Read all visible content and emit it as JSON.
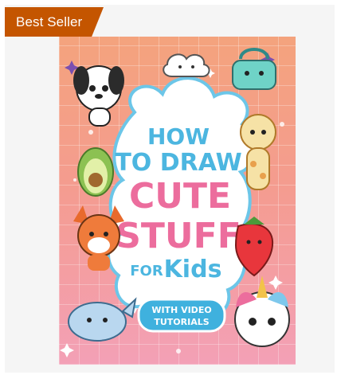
{
  "badge": {
    "label": "Best Seller",
    "color": "#c45500"
  },
  "book": {
    "title_line1": "HOW",
    "title_line2": "TO DRAW",
    "title_line3": "CUTE",
    "title_line4": "STUFF",
    "title_line5_a": "FOR",
    "title_line5_b": "Kids",
    "ribbon_line1": "WITH VIDEO",
    "ribbon_line2": "TUTORIALS",
    "colors": {
      "title_blue": "#4cb6e0",
      "title_pink": "#ec6d9d",
      "ribbon": "#3fb1de"
    },
    "stickers": [
      "puppy-icon",
      "cloud-icon",
      "bag-icon",
      "giraffe-icon",
      "avocado-icon",
      "fox-icon",
      "strawberry-icon",
      "whale-icon",
      "unicorn-icon"
    ]
  }
}
